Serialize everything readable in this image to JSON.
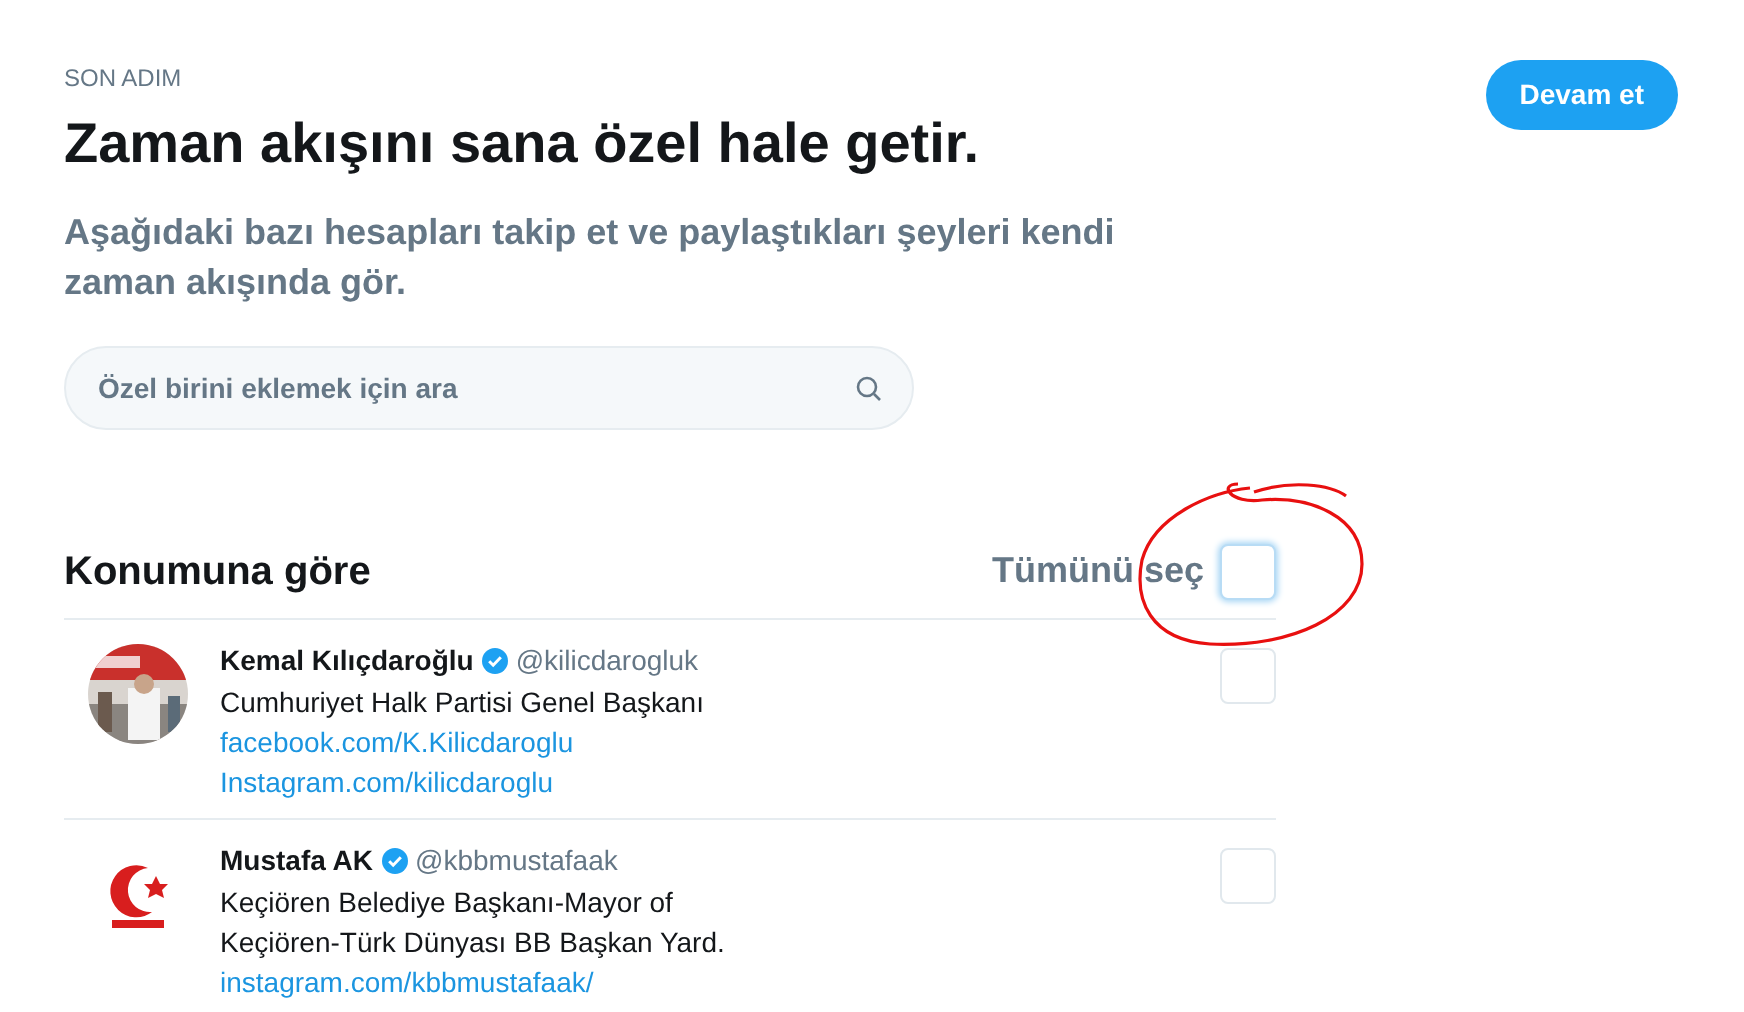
{
  "header": {
    "step": "SON ADIM",
    "title": "Zaman akışını sana özel hale getir.",
    "subtitle": "Aşağıdaki bazı hesapları takip et ve paylaştıkları şeyleri kendi zaman akışında gör.",
    "continue_button": "Devam et"
  },
  "search": {
    "placeholder": "Özel birini eklemek için ara"
  },
  "section": {
    "title": "Konumuna göre",
    "select_all": {
      "label": "Tümünü seç",
      "checked": false
    }
  },
  "accounts": [
    {
      "name": "Kemal Kılıçdaroğlu",
      "verified": true,
      "handle": "@kilicdarogluk",
      "bio": [
        "Cumhuriyet Halk Partisi Genel Başkanı"
      ],
      "links": [
        "facebook.com/K.Kilicdaroglu",
        "Instagram.com/kilicdaroglu"
      ],
      "checked": false,
      "avatar": {
        "kind": "picture"
      }
    },
    {
      "name": "Mustafa AK",
      "verified": true,
      "handle": "@kbbmustafaak",
      "bio": [
        "Keçiören Belediye Başkanı-Mayor of",
        "Keçiören-Türk Dünyası BB Başkan Yard."
      ],
      "links": [
        "instagram.com/kbbmustafaak/"
      ],
      "checked": false,
      "avatar": {
        "kind": "logo"
      }
    }
  ]
}
